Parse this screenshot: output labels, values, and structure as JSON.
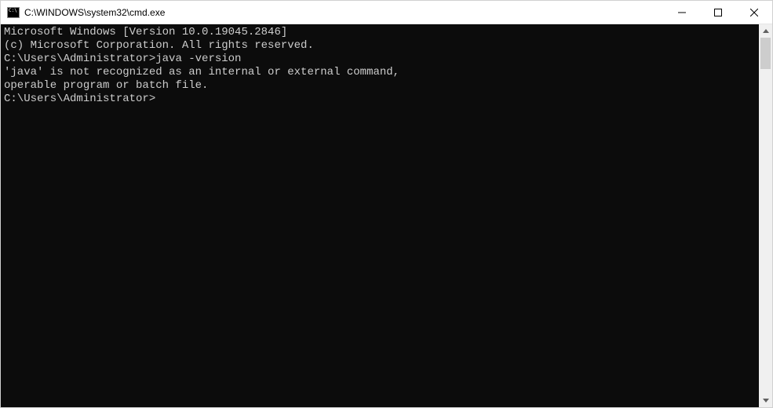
{
  "titlebar": {
    "title": "C:\\WINDOWS\\system32\\cmd.exe"
  },
  "console": {
    "header1": "Microsoft Windows [Version 10.0.19045.2846]",
    "header2": "(c) Microsoft Corporation. All rights reserved.",
    "blank1": "",
    "prompt1_path": "C:\\Users\\Administrator>",
    "prompt1_cmd": "java -version",
    "error1": "'java' is not recognized as an internal or external command,",
    "error2": "operable program or batch file.",
    "blank2": "",
    "prompt2_path": "C:\\Users\\Administrator>"
  }
}
